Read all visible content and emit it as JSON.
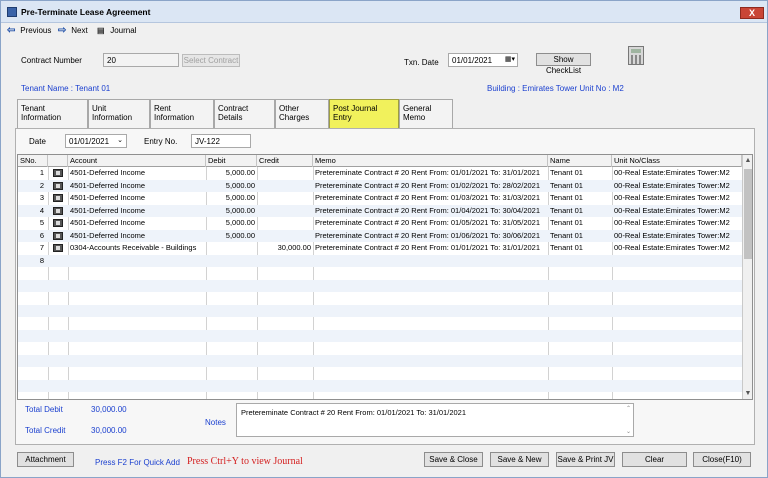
{
  "window": {
    "title": "Pre-Terminate Lease Agreement",
    "close_glyph": "X"
  },
  "toolbar": {
    "previous": "Previous",
    "next": "Next",
    "journal": "Journal"
  },
  "contract": {
    "label": "Contract Number",
    "value": "20",
    "select_button": "Select Contract"
  },
  "txn": {
    "label": "Txn. Date",
    "value": "01/01/2021",
    "checklist_button": "Show CheckList"
  },
  "tenant_line": "Tenant Name : Tenant 01",
  "building_line": "Building : Emirates Tower  Unit No : M2",
  "tabs": [
    {
      "label": "Tenant Information"
    },
    {
      "label": "Unit Information"
    },
    {
      "label": "Rent Information"
    },
    {
      "label": "Contract Details"
    },
    {
      "label": "Other Charges"
    },
    {
      "label": "Post Journal Entry"
    },
    {
      "label": "General Memo"
    }
  ],
  "entry": {
    "date_label": "Date",
    "date_value": "01/01/2021",
    "entry_label": "Entry No.",
    "entry_value": "JV-122"
  },
  "grid": {
    "headers": [
      "SNo.",
      "",
      "Account",
      "Debit",
      "Credit",
      "Memo",
      "Name",
      "Unit No/Class"
    ],
    "rows": [
      {
        "sno": "1",
        "account": "4501-Deferred Income",
        "debit": "5,000.00",
        "credit": "",
        "memo": "Pretereminate Contract # 20 Rent From: 01/01/2021 To: 31/01/2021",
        "name": "Tenant 01",
        "unit": "00-Real Estate:Emirates Tower:M2"
      },
      {
        "sno": "2",
        "account": "4501-Deferred Income",
        "debit": "5,000.00",
        "credit": "",
        "memo": "Pretereminate Contract # 20 Rent From: 01/02/2021 To: 28/02/2021",
        "name": "Tenant 01",
        "unit": "00-Real Estate:Emirates Tower:M2"
      },
      {
        "sno": "3",
        "account": "4501-Deferred Income",
        "debit": "5,000.00",
        "credit": "",
        "memo": "Pretereminate Contract # 20 Rent From: 01/03/2021 To: 31/03/2021",
        "name": "Tenant 01",
        "unit": "00-Real Estate:Emirates Tower:M2"
      },
      {
        "sno": "4",
        "account": "4501-Deferred Income",
        "debit": "5,000.00",
        "credit": "",
        "memo": "Pretereminate Contract # 20 Rent From: 01/04/2021 To: 30/04/2021",
        "name": "Tenant 01",
        "unit": "00-Real Estate:Emirates Tower:M2"
      },
      {
        "sno": "5",
        "account": "4501-Deferred Income",
        "debit": "5,000.00",
        "credit": "",
        "memo": "Pretereminate Contract # 20 Rent From: 01/05/2021 To: 31/05/2021",
        "name": "Tenant 01",
        "unit": "00-Real Estate:Emirates Tower:M2"
      },
      {
        "sno": "6",
        "account": "4501-Deferred Income",
        "debit": "5,000.00",
        "credit": "",
        "memo": "Pretereminate Contract # 20 Rent From: 01/06/2021 To: 30/06/2021",
        "name": "Tenant 01",
        "unit": "00-Real Estate:Emirates Tower:M2"
      },
      {
        "sno": "7",
        "account": "0304-Accounts Receivable - Buildings",
        "debit": "",
        "credit": "30,000.00",
        "memo": "Pretereminate Contract # 20 Rent From: 01/01/2021 To: 31/01/2021",
        "name": "Tenant 01",
        "unit": "00-Real Estate:Emirates Tower:M2"
      },
      {
        "sno": "8",
        "account": "",
        "debit": "",
        "credit": "",
        "memo": "",
        "name": "",
        "unit": ""
      }
    ]
  },
  "totals": {
    "debit_label": "Total Debit",
    "debit_value": "30,000.00",
    "credit_label": "Total Credit",
    "credit_value": "30,000.00"
  },
  "notes": {
    "label": "Notes",
    "value": "Pretereminate Contract # 20 Rent From: 01/01/2021 To: 31/01/2021"
  },
  "footer": {
    "attachment": "Attachment",
    "quick_add": "Press F2 For Quick Add",
    "view_journal": "Press Ctrl+Y to view Journal",
    "save_close": "Save & Close",
    "save_new": "Save & New",
    "save_print": "Save & Print JV",
    "clear": "Clear",
    "close": "Close(F10)"
  },
  "icons": {
    "previous": "left-arrow-icon",
    "next": "right-arrow-icon",
    "journal": "journal-icon",
    "calculator": "calculator-icon",
    "row": "row-detail-icon"
  },
  "colors": {
    "accent_blue": "#1a3fcf",
    "active_tab": "#f1f15c",
    "hint_red": "#d42020",
    "close_red": "#c94536"
  }
}
